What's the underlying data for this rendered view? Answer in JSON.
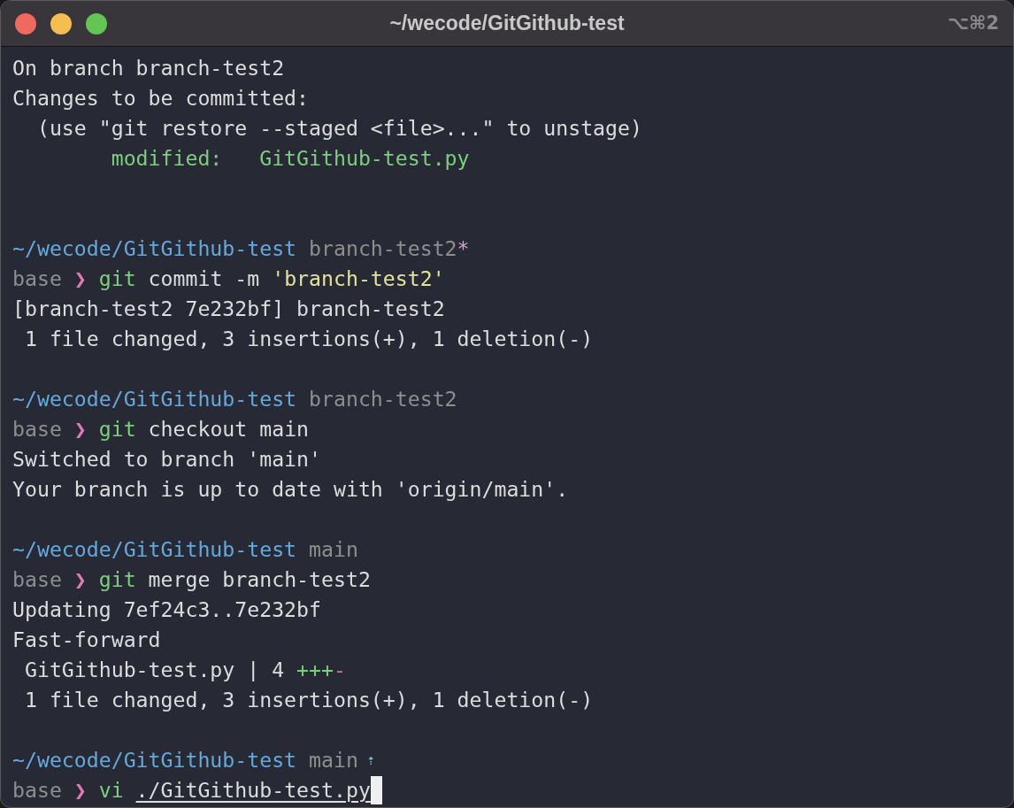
{
  "window": {
    "title": "~/wecode/GitGithub-test",
    "shortcut": "⌥⌘2"
  },
  "blocks": [
    {
      "lines": [
        {
          "segments": [
            {
              "text": "On branch branch-test2",
              "kind": "plain"
            }
          ]
        },
        {
          "segments": [
            {
              "text": "Changes to be committed:",
              "kind": "plain"
            }
          ]
        },
        {
          "segments": [
            {
              "text": "  (use \"git restore --staged <file>...\" to unstage)",
              "kind": "plain"
            }
          ]
        },
        {
          "segments": [
            {
              "text": "        modified:   GitGithub-test.py",
              "kind": "modified"
            }
          ]
        }
      ]
    },
    {
      "lines": [
        {
          "segments": [
            {
              "text": "~/wecode/GitGithub-test",
              "kind": "path"
            },
            {
              "text": " branch-test2",
              "kind": "branch"
            },
            {
              "text": "*",
              "kind": "dirty"
            }
          ]
        },
        {
          "segments": [
            {
              "text": "base",
              "kind": "env"
            },
            {
              "text": " ❯ ",
              "kind": "prompt"
            },
            {
              "text": "git",
              "kind": "command"
            },
            {
              "text": " commit -m ",
              "kind": "args"
            },
            {
              "text": "'branch-test2'",
              "kind": "string"
            }
          ]
        },
        {
          "segments": [
            {
              "text": "[branch-test2 7e232bf] branch-test2",
              "kind": "plain"
            }
          ]
        },
        {
          "segments": [
            {
              "text": " 1 file changed, 3 insertions(+), 1 deletion(-)",
              "kind": "plain"
            }
          ]
        }
      ]
    },
    {
      "lines": [
        {
          "segments": [
            {
              "text": "~/wecode/GitGithub-test",
              "kind": "path"
            },
            {
              "text": " branch-test2",
              "kind": "branch"
            }
          ]
        },
        {
          "segments": [
            {
              "text": "base",
              "kind": "env"
            },
            {
              "text": " ❯ ",
              "kind": "prompt"
            },
            {
              "text": "git",
              "kind": "command"
            },
            {
              "text": " checkout main",
              "kind": "args"
            }
          ]
        },
        {
          "segments": [
            {
              "text": "Switched to branch 'main'",
              "kind": "plain"
            }
          ]
        },
        {
          "segments": [
            {
              "text": "Your branch is up to date with 'origin/main'.",
              "kind": "plain"
            }
          ]
        }
      ]
    },
    {
      "lines": [
        {
          "segments": [
            {
              "text": "~/wecode/GitGithub-test",
              "kind": "path"
            },
            {
              "text": " main",
              "kind": "branch"
            }
          ]
        },
        {
          "segments": [
            {
              "text": "base",
              "kind": "env"
            },
            {
              "text": " ❯ ",
              "kind": "prompt"
            },
            {
              "text": "git",
              "kind": "command"
            },
            {
              "text": " merge branch-test2",
              "kind": "args"
            }
          ]
        },
        {
          "segments": [
            {
              "text": "Updating 7ef24c3..7e232bf",
              "kind": "plain"
            }
          ]
        },
        {
          "segments": [
            {
              "text": "Fast-forward",
              "kind": "plain"
            }
          ]
        },
        {
          "segments": [
            {
              "text": " GitGithub-test.py | 4 ",
              "kind": "plain"
            },
            {
              "text": "+++",
              "kind": "added"
            },
            {
              "text": "-",
              "kind": "removed"
            }
          ]
        },
        {
          "segments": [
            {
              "text": " 1 file changed, 3 insertions(+), 1 deletion(-)",
              "kind": "plain"
            }
          ]
        }
      ]
    },
    {
      "lines": [
        {
          "segments": [
            {
              "text": "~/wecode/GitGithub-test",
              "kind": "path"
            },
            {
              "text": " main",
              "kind": "branch"
            },
            {
              "text": " ⇡",
              "kind": "ahead"
            }
          ]
        },
        {
          "segments": [
            {
              "text": "base",
              "kind": "env"
            },
            {
              "text": " ❯ ",
              "kind": "prompt"
            },
            {
              "text": "vi",
              "kind": "command"
            },
            {
              "text": "./GitGithub-test.py",
              "kind": "file"
            }
          ],
          "cursor": true
        }
      ]
    }
  ]
}
